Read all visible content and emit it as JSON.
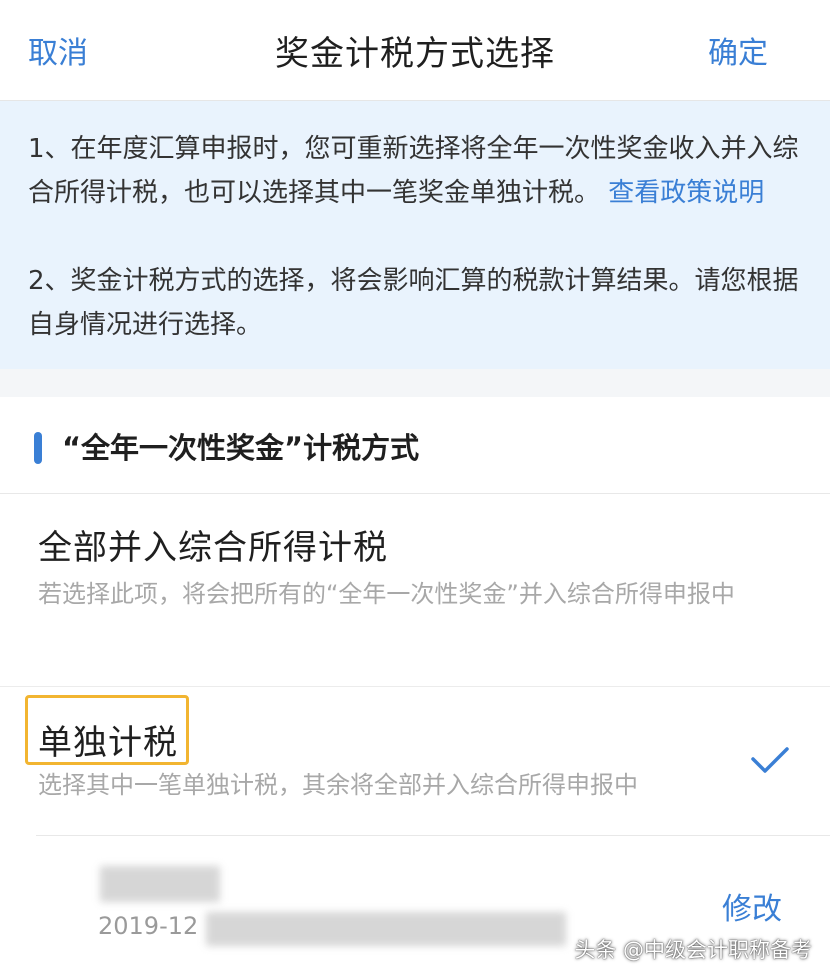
{
  "header": {
    "cancel_label": "取消",
    "title": "奖金计税方式选择",
    "confirm_label": "确定"
  },
  "notice": {
    "line1_text": "1、在年度汇算申报时，您可重新选择将全年一次性奖金收入并入综合所得计税，也可以选择其中一笔奖金单独计税。",
    "policy_link": "查看政策说明",
    "line2_text": "2、奖金计税方式的选择，将会影响汇算的税款计算结果。请您根据自身情况进行选择。"
  },
  "section": {
    "title": "“全年一次性奖金”计税方式"
  },
  "options": [
    {
      "title": "全部并入综合所得计税",
      "description": "若选择此项，将会把所有的“全年一次性奖金”并入综合所得申报中",
      "selected": false
    },
    {
      "title": "单独计税",
      "description": "选择其中一笔单独计税，其余将全部并入综合所得申报中",
      "selected": true
    }
  ],
  "bonus_item": {
    "date_prefix": "2019-12",
    "edit_label": "修改"
  },
  "watermark": "头条 @中级会计职称备考",
  "colors": {
    "accent_blue": "#3a7fd5",
    "notice_bg": "#e9f3fd",
    "highlight_box": "#f2b531"
  },
  "icons": {
    "selected_mark": "checkmark-icon",
    "section_marker": "accent-bar"
  }
}
